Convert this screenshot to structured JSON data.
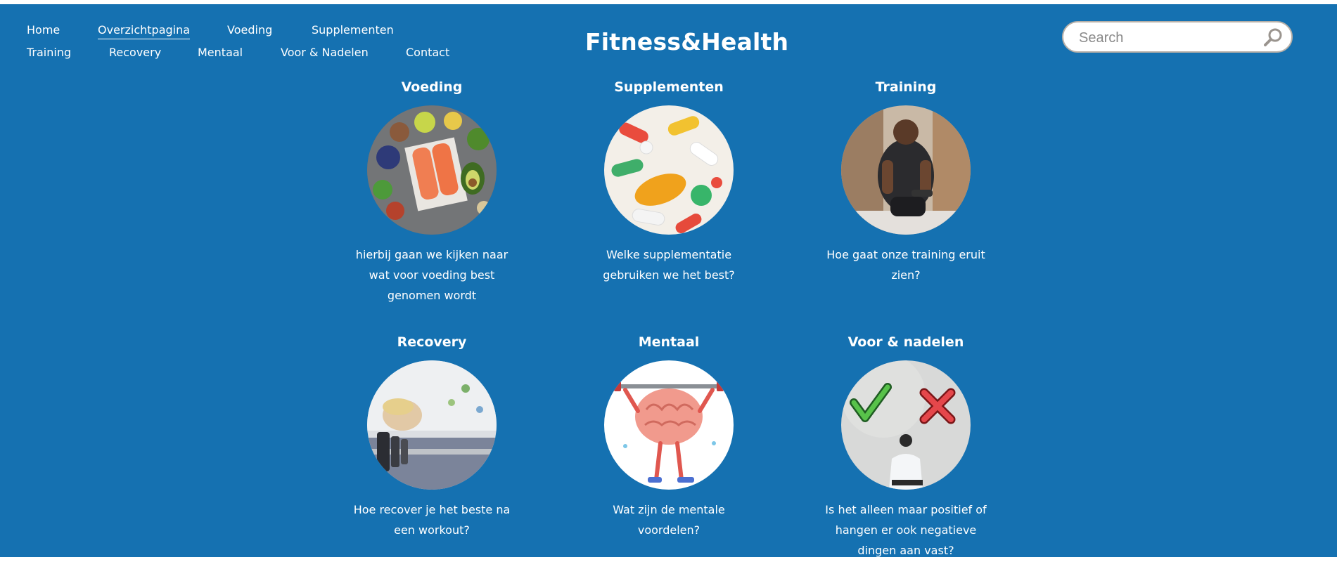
{
  "nav": {
    "items": [
      {
        "label": "Home"
      },
      {
        "label": "Overzichtpagina"
      },
      {
        "label": "Voeding"
      },
      {
        "label": "Supplementen"
      },
      {
        "label": "Training"
      },
      {
        "label": "Recovery"
      },
      {
        "label": "Mentaal"
      },
      {
        "label": "Voor & Nadelen"
      },
      {
        "label": "Contact"
      }
    ],
    "active_index": 1
  },
  "site_title": "Fitness&Health",
  "search": {
    "placeholder": "Search",
    "value": ""
  },
  "cards": [
    {
      "title": "Voeding",
      "description": "hierbij gaan we kijken naar wat voor voeding best genomen wordt"
    },
    {
      "title": "Supplementen",
      "description": "Welke supplementatie gebruiken we het best?"
    },
    {
      "title": "Training",
      "description": "Hoe gaat onze training eruit zien?"
    },
    {
      "title": "Recovery",
      "description": "Hoe recover je het beste na een workout?"
    },
    {
      "title": "Mentaal",
      "description": "Wat zijn de mentale voordelen?"
    },
    {
      "title": "Voor & nadelen",
      "description": "Is het alleen maar positief of hangen er ook negatieve dingen aan vast?"
    }
  ],
  "colors": {
    "background": "#1571b1",
    "text": "#ffffff",
    "search_border": "#b7b0a8"
  },
  "icons": {
    "search": "magnifier-icon"
  }
}
